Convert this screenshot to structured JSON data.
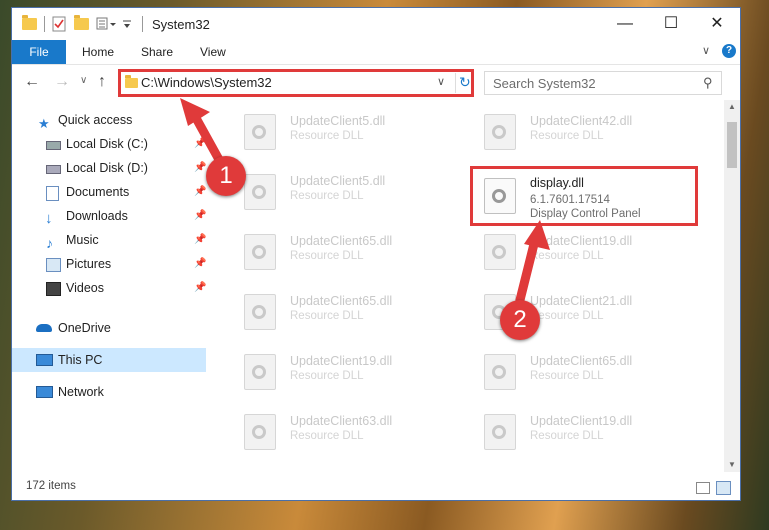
{
  "window": {
    "title": "System32"
  },
  "ribbon": {
    "tabs": [
      "File",
      "Home",
      "Share",
      "View"
    ]
  },
  "nav": {
    "address": "C:\\Windows\\System32",
    "search_placeholder": "Search System32"
  },
  "sidebar": {
    "items": [
      {
        "label": "Quick access",
        "icon": "star-icon"
      },
      {
        "label": "Local Disk (C:)",
        "icon": "drive-icon",
        "pinned": true
      },
      {
        "label": "Local Disk (D:)",
        "icon": "drive-icon",
        "pinned": true
      },
      {
        "label": "Documents",
        "icon": "documents-icon",
        "pinned": true
      },
      {
        "label": "Downloads",
        "icon": "downloads-icon",
        "pinned": true
      },
      {
        "label": "Music",
        "icon": "music-icon",
        "pinned": true
      },
      {
        "label": "Pictures",
        "icon": "pictures-icon",
        "pinned": true
      },
      {
        "label": "Videos",
        "icon": "videos-icon",
        "pinned": true
      },
      {
        "label": "OneDrive",
        "icon": "cloud-icon"
      },
      {
        "label": "This PC",
        "icon": "computer-icon",
        "selected": true
      },
      {
        "label": "Network",
        "icon": "network-icon"
      }
    ]
  },
  "files": {
    "left": [
      {
        "name": "UpdateClient5.dll",
        "type": "Resource DLL"
      },
      {
        "name": "UpdateClient5.dll",
        "type": "Resource DLL"
      },
      {
        "name": "UpdateClient65.dll",
        "type": "Resource DLL"
      },
      {
        "name": "UpdateClient65.dll",
        "type": "Resource DLL"
      },
      {
        "name": "UpdateClient19.dll",
        "type": "Resource DLL"
      },
      {
        "name": "UpdateClient63.dll",
        "type": "Resource DLL"
      }
    ],
    "right_top": {
      "name": "UpdateClient42.dll",
      "type": "Resource DLL"
    },
    "highlighted": {
      "name": "display.dll",
      "version": "6.1.7601.17514",
      "description": "Display Control Panel"
    },
    "right": [
      {
        "name": "UpdateClient19.dll",
        "type": "Resource DLL"
      },
      {
        "name": "UpdateClient21.dll",
        "type": "Resource DLL"
      },
      {
        "name": "UpdateClient65.dll",
        "type": "Resource DLL"
      },
      {
        "name": "UpdateClient19.dll",
        "type": "Resource DLL"
      }
    ]
  },
  "status": {
    "items_count": "172 items"
  },
  "callouts": [
    "1",
    "2"
  ],
  "colors": {
    "accent": "#1979ca",
    "callout": "#e03a3a",
    "selected": "#cce8ff"
  }
}
